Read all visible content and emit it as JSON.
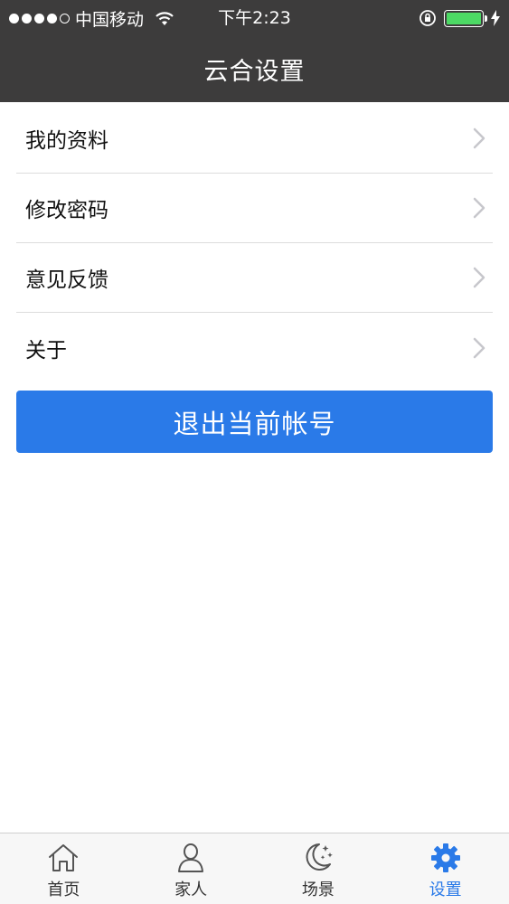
{
  "status_bar": {
    "carrier": "中国移动",
    "time": "下午2:23",
    "battery_color": "#4cd964"
  },
  "nav": {
    "title": "云合设置"
  },
  "menu": {
    "items": [
      {
        "label": "我的资料"
      },
      {
        "label": "修改密码"
      },
      {
        "label": "意见反馈"
      },
      {
        "label": "关于"
      }
    ]
  },
  "logout": {
    "label": "退出当前帐号",
    "color": "#2a7ae8"
  },
  "tab_bar": {
    "tabs": [
      {
        "label": "首页",
        "icon": "home-icon"
      },
      {
        "label": "家人",
        "icon": "person-icon"
      },
      {
        "label": "场景",
        "icon": "moon-stars-icon"
      },
      {
        "label": "设置",
        "icon": "gear-icon",
        "active": true
      }
    ],
    "active_color": "#2a7ae8"
  }
}
